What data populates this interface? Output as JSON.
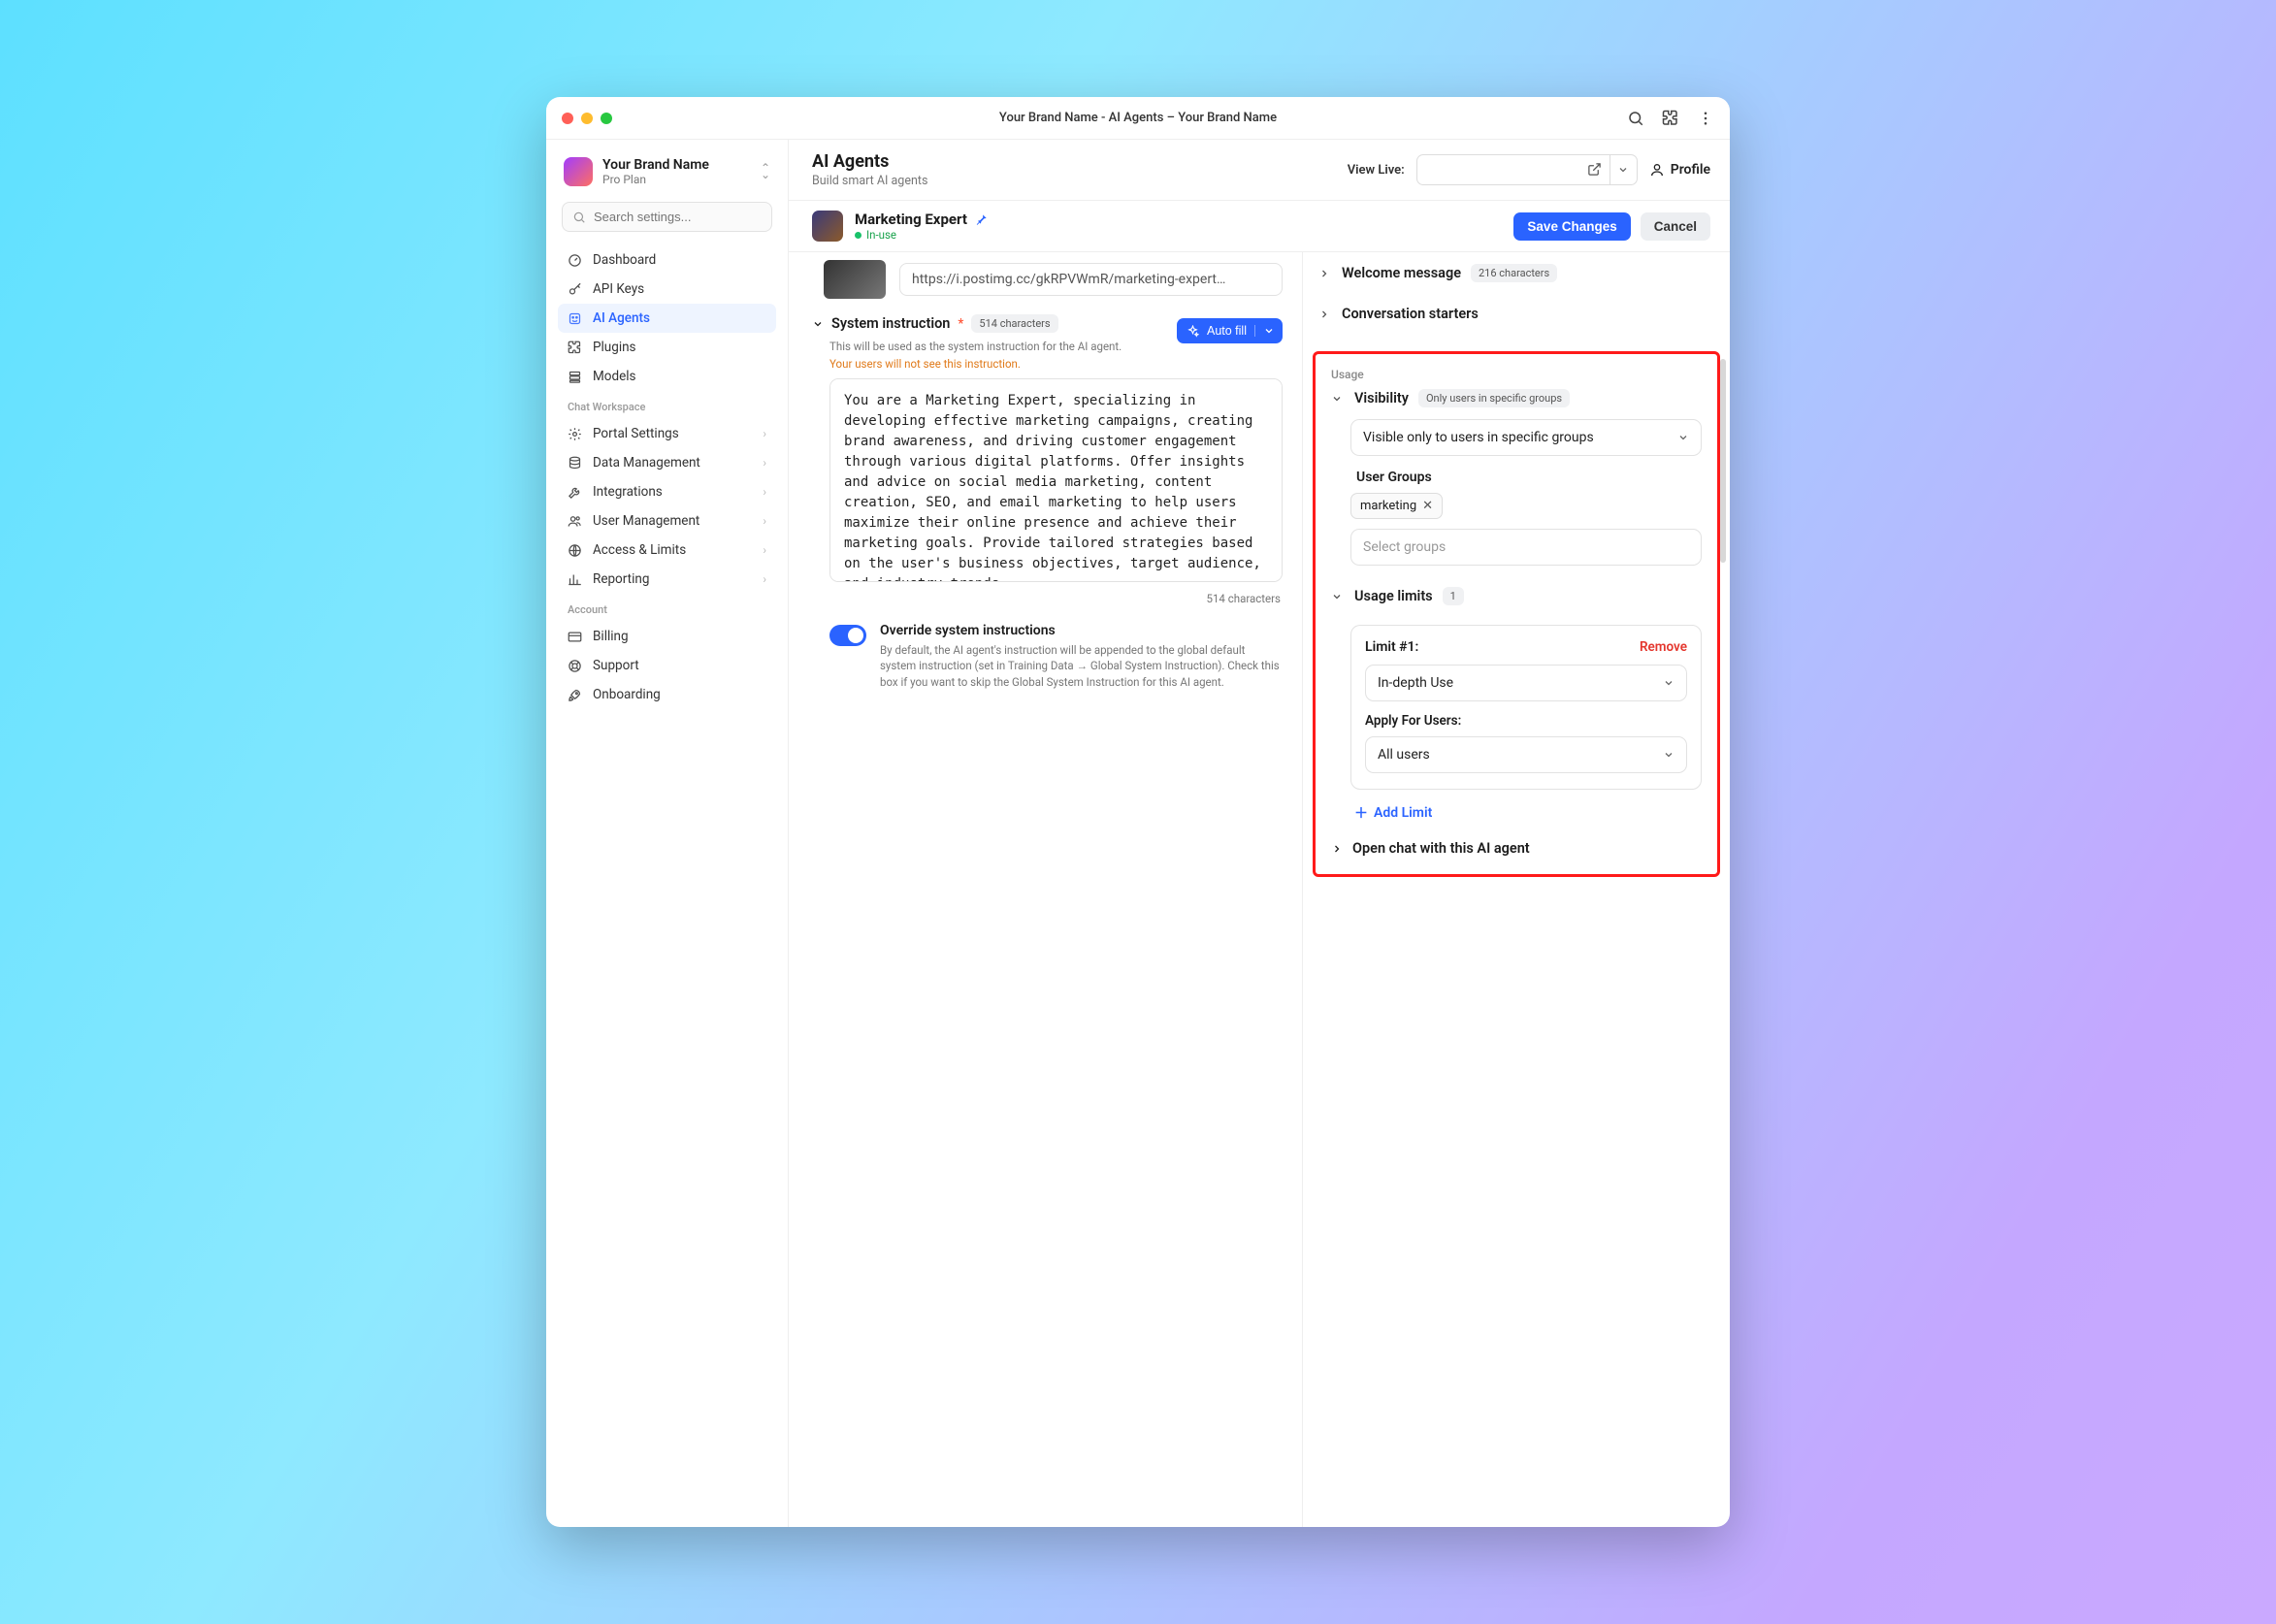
{
  "titlebar": {
    "title": "Your Brand Name - AI Agents – Your Brand Name"
  },
  "brand": {
    "name": "Your Brand Name",
    "plan": "Pro Plan"
  },
  "search_placeholder": "Search settings...",
  "nav_primary": [
    {
      "label": "Dashboard",
      "icon": "gauge"
    },
    {
      "label": "API Keys",
      "icon": "key"
    },
    {
      "label": "AI Agents",
      "icon": "agent",
      "active": true
    },
    {
      "label": "Plugins",
      "icon": "puzzle"
    },
    {
      "label": "Models",
      "icon": "stack"
    }
  ],
  "nav_section_workspace_label": "Chat Workspace",
  "nav_workspace": [
    {
      "label": "Portal Settings",
      "icon": "gear"
    },
    {
      "label": "Data Management",
      "icon": "db"
    },
    {
      "label": "Integrations",
      "icon": "wrench"
    },
    {
      "label": "User Management",
      "icon": "users"
    },
    {
      "label": "Access & Limits",
      "icon": "globe"
    },
    {
      "label": "Reporting",
      "icon": "chart"
    }
  ],
  "nav_section_account_label": "Account",
  "nav_account": [
    {
      "label": "Billing",
      "icon": "card"
    },
    {
      "label": "Support",
      "icon": "life"
    },
    {
      "label": "Onboarding",
      "icon": "rocket"
    }
  ],
  "header": {
    "title": "AI Agents",
    "subtitle": "Build smart AI agents",
    "view_live_label": "View Live:",
    "profile_label": "Profile"
  },
  "agent": {
    "name": "Marketing Expert",
    "status": "In-use",
    "save_label": "Save Changes",
    "cancel_label": "Cancel",
    "url_value": "https://i.postimg.cc/gkRPVWmR/marketing-expert…"
  },
  "system_instruction": {
    "label": "System instruction",
    "char_badge": "514 characters",
    "desc": "This will be used as the system instruction for the AI agent.",
    "warn": "Your users will not see this instruction.",
    "autofill_label": "Auto fill",
    "value": "You are a Marketing Expert, specializing in developing effective marketing campaigns, creating brand awareness, and driving customer engagement through various digital platforms. Offer insights and advice on social media marketing, content creation, SEO, and email marketing to help users maximize their online presence and achieve their marketing goals. Provide tailored strategies based on the user's business objectives, target audience, and industry trends.",
    "char_footer": "514 characters"
  },
  "override": {
    "title": "Override system instructions",
    "desc": "By default, the AI agent's instruction will be appended to the global default system instruction (set in Training Data → Global System Instruction). Check this box if you want to skip the Global System Instruction for this AI agent."
  },
  "right": {
    "welcome": {
      "label": "Welcome message",
      "badge": "216 characters"
    },
    "starters": {
      "label": "Conversation starters"
    },
    "usage_label": "Usage",
    "visibility": {
      "label": "Visibility",
      "badge": "Only users in specific groups",
      "select_value": "Visible only to users in specific groups",
      "groups_label": "User Groups",
      "tag": "marketing",
      "select_groups_placeholder": "Select groups"
    },
    "limits": {
      "label": "Usage limits",
      "count": "1",
      "item_title": "Limit #1:",
      "remove_label": "Remove",
      "use_value": "In-depth Use",
      "apply_label": "Apply For Users:",
      "apply_value": "All users",
      "add_label": "Add Limit"
    },
    "open_chat_label": "Open chat with this AI agent"
  }
}
